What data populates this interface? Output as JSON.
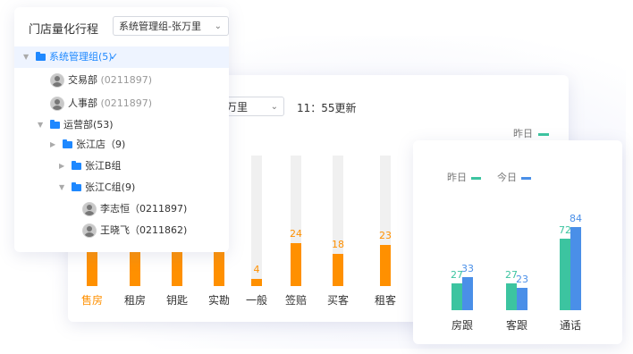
{
  "store_panel": {
    "title": "门店量化行程",
    "selected": "系统管理组-张万里",
    "tree": [
      {
        "label": "系统管理组(5)",
        "code": "",
        "type": "folder",
        "expanded": true,
        "selected": true
      },
      {
        "label": "交易部",
        "code": "(0211897)",
        "type": "user"
      },
      {
        "label": "人事部",
        "code": "(0211897)",
        "type": "user"
      },
      {
        "label": "运营部(53)",
        "code": "",
        "type": "folder",
        "expanded": true
      },
      {
        "label": "张江店（9)",
        "code": "",
        "type": "folder",
        "expanded": false
      },
      {
        "label": "张江B组",
        "code": "",
        "type": "folder",
        "expanded": false
      },
      {
        "label": "张江C组(9)",
        "code": "",
        "type": "folder",
        "expanded": true
      },
      {
        "label": "李志恒（0211897)",
        "code": "",
        "type": "user"
      },
      {
        "label": "王晓飞（0211862)",
        "code": "",
        "type": "user"
      }
    ]
  },
  "activity_panel": {
    "select_value": "万里",
    "update_time": "11：55更新",
    "legend": "昨日",
    "colors": {
      "bar": "#ff9000",
      "track": "#f0f0f0",
      "legend": "#3cc4a0"
    }
  },
  "compare_panel": {
    "legend_yesterday": "昨日",
    "legend_today": "今日",
    "colors": {
      "yesterday": "#3cc4a0",
      "today": "#4a8fe8"
    }
  },
  "chart_data": [
    {
      "type": "bar",
      "categories": [
        "售房",
        "租房",
        "钥匙",
        "实勘",
        "一般",
        "签赔",
        "买客",
        "租客"
      ],
      "values": [
        null,
        null,
        null,
        null,
        4,
        24,
        18,
        23
      ],
      "active_category": "售房",
      "ylim": [
        0,
        100
      ]
    },
    {
      "type": "bar",
      "categories": [
        "房跟",
        "客跟",
        "通话"
      ],
      "series": [
        {
          "name": "昨日",
          "values": [
            27,
            27,
            72
          ]
        },
        {
          "name": "今日",
          "values": [
            33,
            23,
            84
          ]
        }
      ]
    }
  ]
}
